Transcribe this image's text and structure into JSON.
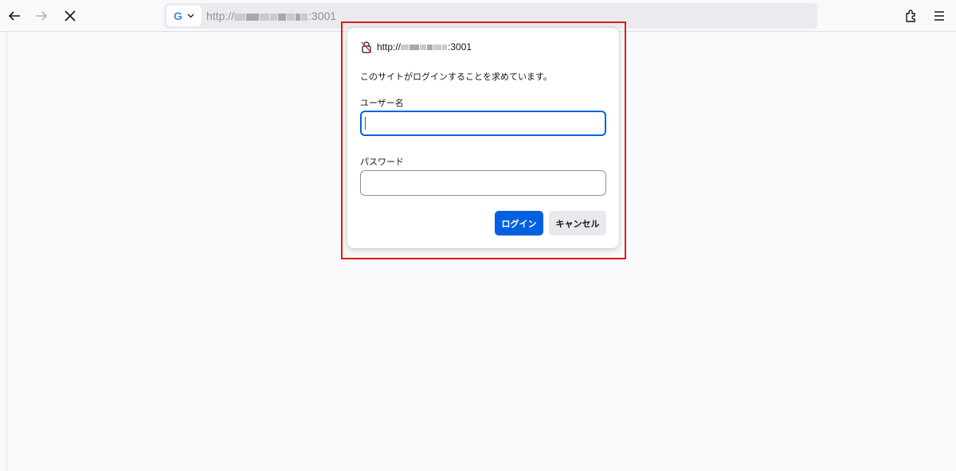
{
  "browser": {
    "url_prefix": "http://",
    "url_suffix": ":3001",
    "search_engine_letter": "G",
    "colors": {
      "accent": "#0061e0",
      "highlight": "#e0191b"
    }
  },
  "auth_dialog": {
    "origin_prefix": "http://",
    "origin_suffix": ":3001",
    "message": "このサイトがログインすることを求めています。",
    "username_label": "ユーザー名",
    "username_value": "",
    "password_label": "パスワード",
    "password_value": "",
    "login_button": "ログイン",
    "cancel_button": "キャンセル"
  },
  "icons": {
    "back": "arrow-left-icon",
    "forward": "arrow-right-icon",
    "stop": "close-icon",
    "engine_menu": "chevron-down-icon",
    "extensions": "puzzle-icon",
    "menu": "hamburger-menu-icon",
    "insecure": "insecure-lock-icon"
  }
}
